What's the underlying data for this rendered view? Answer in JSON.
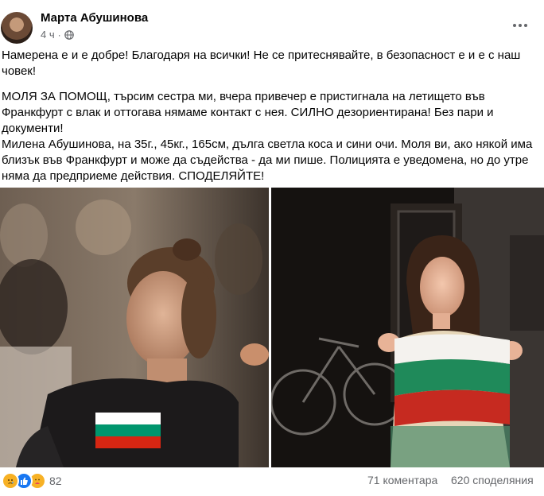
{
  "post": {
    "author": "Марта Абушинова",
    "time": "4 ч",
    "separator": "·",
    "privacy_icon": "globe-icon",
    "more_icon": "more-horizontal-icon",
    "text": {
      "line1": "Намерена е и е добре! Благодаря на всички! Не се притеснявайте, в безопасност е и е с наш",
      "line2": "човек!",
      "line3": "МОЛЯ ЗА ПОМОЩ, търсим сестра ми, вчера привечер е пристигнала на летището във",
      "line4": "Франкфурт с влак и оттогава нямаме контакт с нея. СИЛНО дезориентирана! Без пари и",
      "line5": "документи!",
      "line6": "Милена Абушинова, на 35г., 45кг., 165см, дълга светла коса и сини очи. Моля ви, ако някой има",
      "line7": "близък във Франкфурт и може да съдейства - да ми пише. Полицията е уведомена, но до утре",
      "line8": "няма да предприеме действия. СПОДЕЛЯЙТЕ!"
    },
    "photos": [
      "photo-left",
      "photo-right"
    ],
    "flag_colors": {
      "white": "#ffffff",
      "green": "#00966e",
      "red": "#d62612"
    }
  },
  "footer": {
    "reaction_icons": [
      "sad-reaction-icon",
      "like-reaction-icon",
      "care-reaction-icon"
    ],
    "reactions_count": "82",
    "comments": "71 коментара",
    "shares": "620 споделяния"
  }
}
